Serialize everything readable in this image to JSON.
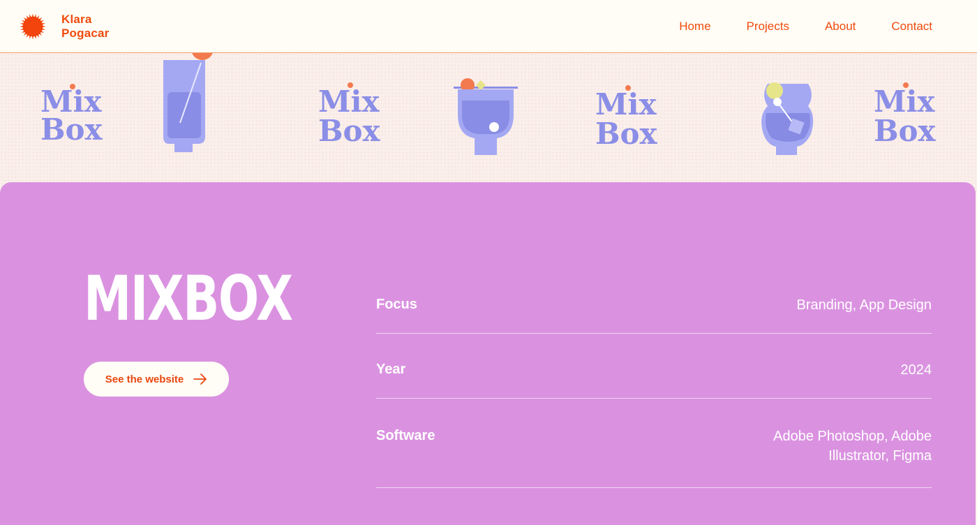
{
  "header": {
    "brand": {
      "first": "Klara",
      "last": "Pogacar",
      "logo_icon": "sun-icon"
    },
    "nav": [
      "Home",
      "Projects",
      "About",
      "Contact"
    ]
  },
  "banner": {
    "logo_line1": "Mix",
    "logo_line2": "Box",
    "colors": {
      "ink": "#8b8ee6",
      "glass": "#a4a8f3",
      "orange": "#f37a4e",
      "yellow": "#e7e58a"
    }
  },
  "project": {
    "title": "MIXBOX",
    "cta_label": "See the website",
    "cta_icon": "arrow-right-icon",
    "details": [
      {
        "key": "Focus",
        "value": "Branding, App Design"
      },
      {
        "key": "Year",
        "value": "2024"
      },
      {
        "key": "Software",
        "value": "Adobe Photoshop, Adobe Illustrator, Figma"
      }
    ]
  },
  "colors": {
    "accent": "#f04a0e",
    "panel": "#da92e0",
    "header_bg": "#fffdf6"
  }
}
